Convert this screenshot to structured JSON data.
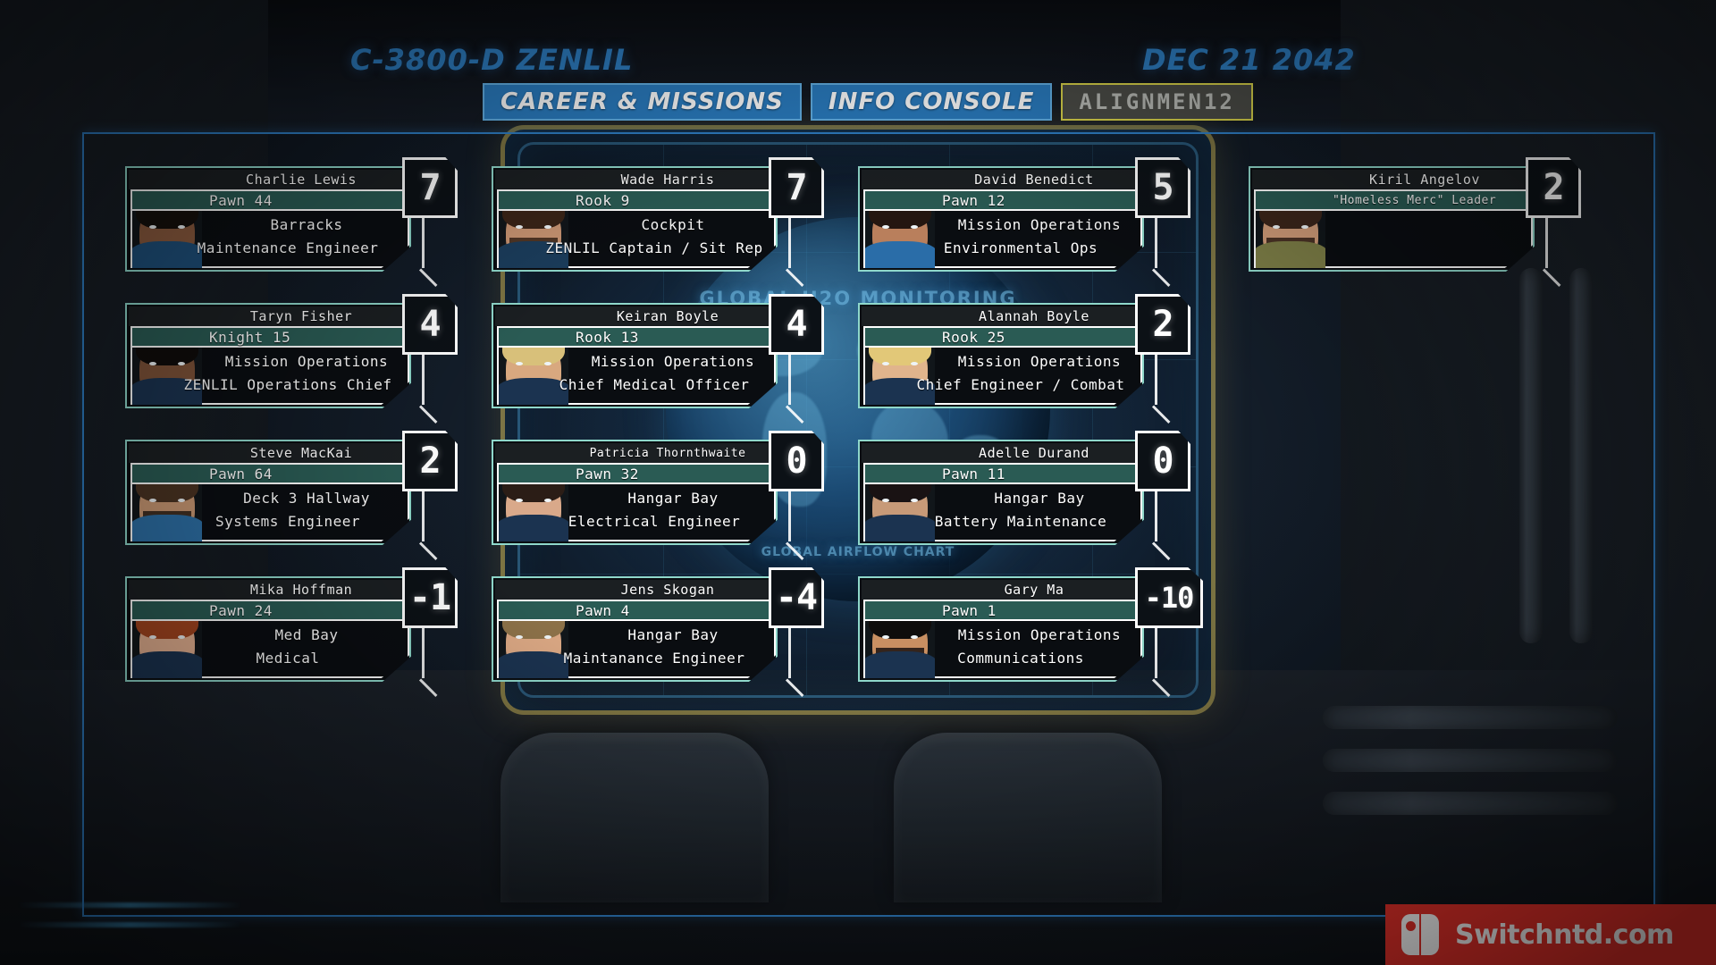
{
  "header": {
    "ship_designation": "C-3800-D ZENLIL",
    "date": "DEC 21 2042",
    "tabs": [
      {
        "label": "CAREER & MISSIONS",
        "state": "active"
      },
      {
        "label": "INFO CONSOLE",
        "state": "active"
      },
      {
        "label": "ALIGNMEN12",
        "state": "current"
      }
    ]
  },
  "holo": {
    "title_top": "GLOBAL H2O MONITORING",
    "title_bottom": "GLOBAL AIRFLOW CHART"
  },
  "crew": [
    {
      "name": "Charlie Lewis",
      "rank": "Pawn 44",
      "location": "Barracks",
      "role": "Maintenance Engineer",
      "score": "7",
      "colors": {
        "skin": "#8a5a3e",
        "hair": "#15100c",
        "body": "#1e4f7a",
        "band": "#c9ccd2",
        "beard": ""
      }
    },
    {
      "name": "Wade Harris",
      "rank": "Rook 9",
      "location": "Cockpit",
      "role": "ZENLIL Captain / Sit Rep",
      "score": "7",
      "colors": {
        "skin": "#c89472",
        "hair": "#3a2417",
        "body": "#1b3d5c",
        "band": "",
        "beard": "#3a2417"
      }
    },
    {
      "name": "David Benedict",
      "rank": "Pawn 12",
      "location": "Mission Operations",
      "role": "Environmental Ops",
      "score": "5",
      "colors": {
        "skin": "#b97f5c",
        "hair": "#241610",
        "body": "#2a6da8",
        "band": "",
        "beard": ""
      }
    },
    {
      "name": "Kiril Angelov",
      "rank": "\"Homeless Merc\" Leader",
      "location": "",
      "role": "",
      "score": "2",
      "colors": {
        "skin": "#cf9b78",
        "hair": "#3b251a",
        "body": "#7c7d46",
        "band": "",
        "beard": "#322016"
      }
    },
    {
      "name": "Taryn Fisher",
      "rank": "Knight 15",
      "location": "Mission Operations",
      "role": "ZENLIL Operations Chief",
      "score": "4",
      "colors": {
        "skin": "#7d5238",
        "hair": "#100c0a",
        "body": "#1b3350",
        "band": "",
        "beard": ""
      }
    },
    {
      "name": "Keiran Boyle",
      "rank": "Rook 13",
      "location": "Mission Operations",
      "role": "Chief Medical Officer",
      "score": "4",
      "colors": {
        "skin": "#d8a87f",
        "hair": "#d8c07a",
        "body": "#1b3350",
        "band": "",
        "beard": ""
      }
    },
    {
      "name": "Alannah Boyle",
      "rank": "Rook 25",
      "location": "Mission Operations",
      "role": "Chief Engineer / Combat",
      "score": "2",
      "colors": {
        "skin": "#e0b48c",
        "hair": "#e2c878",
        "body": "#1b3350",
        "band": "",
        "beard": ""
      }
    },
    {
      "name": "Steve MacKai",
      "rank": "Pawn 64",
      "location": "Deck 3 Hallway",
      "role": "Systems Engineer",
      "score": "2",
      "colors": {
        "skin": "#c99873",
        "hair": "#4a3322",
        "body": "#2d6fa5",
        "band": "",
        "beard": "#2a1d14"
      }
    },
    {
      "name": "Patricia Thornthwaite",
      "rank": "Pawn 32",
      "location": "Hangar Bay",
      "role": "Electrical Engineer",
      "score": "0",
      "colors": {
        "skin": "#d9a98a",
        "hair": "#2b1d16",
        "body": "#1b3350",
        "band": "",
        "beard": ""
      }
    },
    {
      "name": "Adelle Durand",
      "rank": "Pawn 11",
      "location": "Hangar Bay",
      "role": "Battery Maintenance",
      "score": "0",
      "colors": {
        "skin": "#c79a78",
        "hair": "#191213",
        "body": "#1b3350",
        "band": "",
        "beard": ""
      }
    },
    {
      "name": "Mika Hoffman",
      "rank": "Pawn 24",
      "location": "Med Bay",
      "role": "Medical",
      "score": "-1",
      "colors": {
        "skin": "#e5b191",
        "hair": "#a4451f",
        "body": "#1b3350",
        "band": "#b9bec6",
        "beard": ""
      }
    },
    {
      "name": "Jens Skogan",
      "rank": "Pawn 4",
      "location": "Hangar Bay",
      "role": "Maintanance Engineer",
      "score": "-4",
      "colors": {
        "skin": "#dba884",
        "hair": "#8d7249",
        "body": "#1b3350",
        "band": "",
        "beard": ""
      }
    },
    {
      "name": "Gary Ma",
      "rank": "Pawn 1",
      "location": "Mission Operations",
      "role": "Communications",
      "score": "-10",
      "colors": {
        "skin": "#c98f62",
        "hair": "#0f0c0b",
        "body": "#1b3350",
        "band": "",
        "beard": "#1a1210"
      }
    }
  ],
  "watermark": {
    "text": "Switchntd.com",
    "accent": "#e8312a"
  }
}
